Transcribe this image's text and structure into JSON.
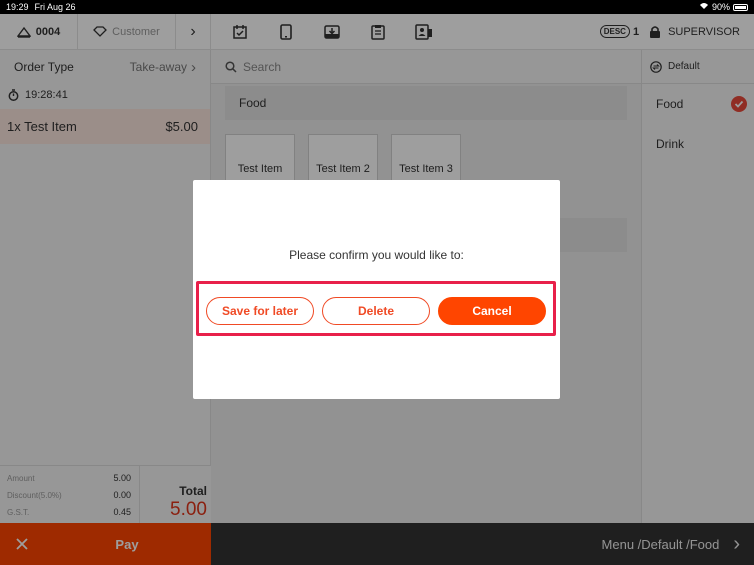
{
  "status_bar": {
    "time": "19:29",
    "date": "Fri Aug 26",
    "wifi": "wifi-icon",
    "battery": "90%"
  },
  "topbar": {
    "order_number": "0004",
    "customer_placeholder": "Customer",
    "desc_badge": "DESC",
    "desc_count": "1",
    "user": "SUPERVISOR",
    "icons": [
      "calendar-check-icon",
      "tablet-icon",
      "download-tray-icon",
      "clipboard-icon",
      "id-card-icon"
    ]
  },
  "order_panel": {
    "order_type_label": "Order Type",
    "order_type_value": "Take-away",
    "timer": "19:28:41",
    "items": [
      {
        "name": "1x Test Item",
        "price": "$5.00"
      }
    ],
    "summary": {
      "amount_label": "Amount",
      "amount_value": "5.00",
      "discount_label": "Discount(5.0%)",
      "discount_value": "0.00",
      "gst_label": "G.S.T.",
      "gst_value": "0.45",
      "total_label": "Total",
      "total_value": "5.00"
    },
    "pay_label": "Pay"
  },
  "main": {
    "search_placeholder": "Search",
    "category_title": "Food",
    "tiles": [
      {
        "label": "Test Item"
      },
      {
        "label": "Test Item 2"
      },
      {
        "label": "Test Item 3"
      }
    ]
  },
  "right_panel": {
    "menu_name": "Default",
    "categories": [
      {
        "label": "Food",
        "selected": true
      },
      {
        "label": "Drink",
        "selected": false
      }
    ]
  },
  "footer": {
    "breadcrumb": "Menu /Default /Food"
  },
  "dialog": {
    "message": "Please confirm you would like to:",
    "save_label": "Save for later",
    "delete_label": "Delete",
    "cancel_label": "Cancel"
  },
  "colors": {
    "accent": "#ff4500",
    "highlight": "#e8204a",
    "bar": "#333333"
  }
}
